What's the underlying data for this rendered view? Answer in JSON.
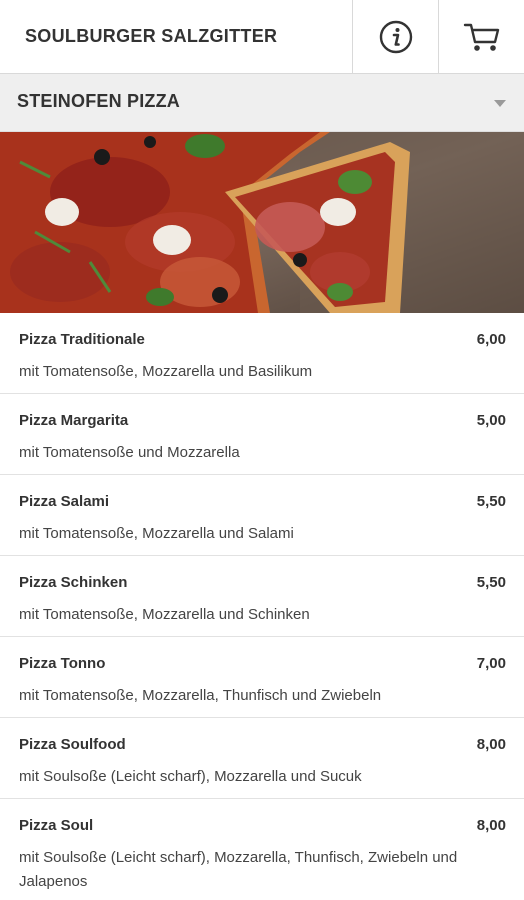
{
  "header": {
    "title": "SOULBURGER SALZGITTER",
    "info_icon": "info-icon",
    "cart_icon": "cart-icon"
  },
  "category": {
    "title": "STEINOFEN PIZZA",
    "caret_icon": "chevron-down-icon"
  },
  "banner": {
    "image": "pizza-photo"
  },
  "items": [
    {
      "name": "Pizza Traditionale",
      "price": "6,00",
      "desc": "mit Tomatensoße, Mozzarella und Basilikum"
    },
    {
      "name": "Pizza Margarita",
      "price": "5,00",
      "desc": "mit Tomatensoße und Mozzarella"
    },
    {
      "name": "Pizza Salami",
      "price": "5,50",
      "desc": "mit Tomatensoße, Mozzarella und Salami"
    },
    {
      "name": "Pizza Schinken",
      "price": "5,50",
      "desc": "mit Tomatensoße, Mozzarella und Schinken"
    },
    {
      "name": "Pizza Tonno",
      "price": "7,00",
      "desc": "mit Tomatensoße, Mozzarella, Thunfisch und Zwiebeln"
    },
    {
      "name": "Pizza Soulfood",
      "price": "8,00",
      "desc": "mit Soulsoße (Leicht scharf), Mozzarella und Sucuk"
    },
    {
      "name": "Pizza Soul",
      "price": "8,00",
      "desc": "mit Soulsoße (Leicht scharf), Mozzarella, Thunfisch, Zwiebeln und Jalapenos"
    }
  ],
  "colors": {
    "header_bg": "#ffffff",
    "category_bg": "#efefef",
    "text": "#333333",
    "divider": "#e2e2e2"
  }
}
